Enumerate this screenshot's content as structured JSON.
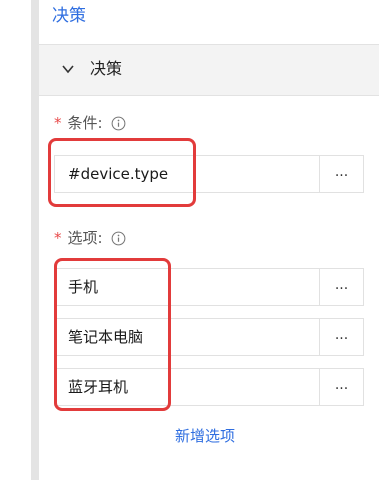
{
  "panel": {
    "title": "决策"
  },
  "section": {
    "label": "决策"
  },
  "condition": {
    "label": "条件:",
    "required_mark": "*",
    "value": "#device.type",
    "more_label": "..."
  },
  "options": {
    "label": "选项:",
    "required_mark": "*",
    "items": [
      {
        "value": "手机",
        "more_label": "..."
      },
      {
        "value": "笔记本电脑",
        "more_label": "..."
      },
      {
        "value": "蓝牙耳机",
        "more_label": "..."
      }
    ],
    "add_label": "新增选项"
  },
  "colors": {
    "accent": "#2f6ee0",
    "required": "#e84a4a",
    "highlight": "#e23b3b",
    "header_bg": "#f3f3f3"
  }
}
